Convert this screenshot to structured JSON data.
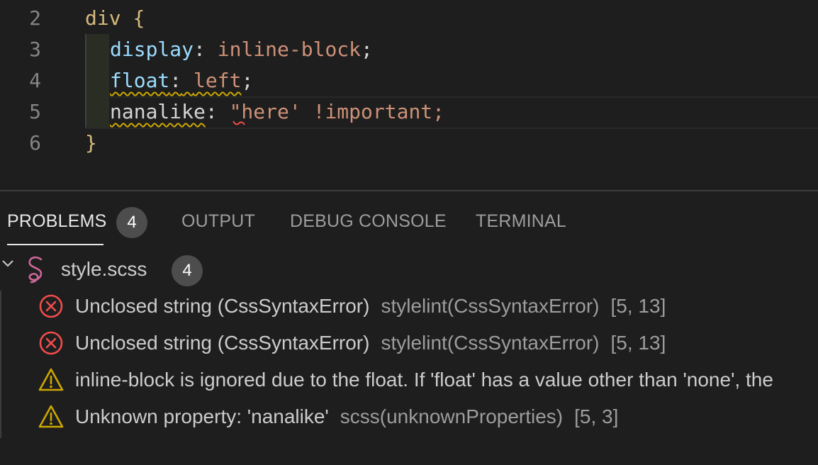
{
  "editor": {
    "lines": [
      {
        "num": "2",
        "selector": "div",
        "brace": "{"
      },
      {
        "num": "3",
        "prop": "display",
        "colon": ":",
        "value": "inline-block",
        "semi": ";"
      },
      {
        "num": "4",
        "prop": "float",
        "colon": ":",
        "value": "left",
        "semi": ";"
      },
      {
        "num": "5",
        "prop": "nanalike",
        "colon": ":",
        "value": "\"here' !important;"
      },
      {
        "num": "6",
        "brace": "}"
      }
    ]
  },
  "panel": {
    "tabs": [
      {
        "label": "PROBLEMS",
        "badge": "4",
        "active": true
      },
      {
        "label": "OUTPUT"
      },
      {
        "label": "DEBUG CONSOLE"
      },
      {
        "label": "TERMINAL"
      }
    ],
    "file": {
      "name": "style.scss",
      "count": "4",
      "icon": "sass-icon"
    },
    "problems": [
      {
        "severity": "error",
        "icon": "error-icon",
        "message": "Unclosed string (CssSyntaxError)",
        "source": "stylelint(CssSyntaxError)",
        "position": "[5, 13]"
      },
      {
        "severity": "error",
        "icon": "error-icon",
        "message": "Unclosed string (CssSyntaxError)",
        "source": "stylelint(CssSyntaxError)",
        "position": "[5, 13]"
      },
      {
        "severity": "warning",
        "icon": "warning-icon",
        "message": "inline-block is ignored due to the float. If 'float' has a value other than 'none', the"
      },
      {
        "severity": "warning",
        "icon": "warning-icon",
        "message": "Unknown property: 'nanalike'",
        "source": "scss(unknownProperties)",
        "position": "[5, 3]"
      }
    ]
  },
  "colors": {
    "error": "#f14c4c",
    "warning": "#cca700",
    "background": "#1e1e1e",
    "sass": "#cd6799"
  }
}
